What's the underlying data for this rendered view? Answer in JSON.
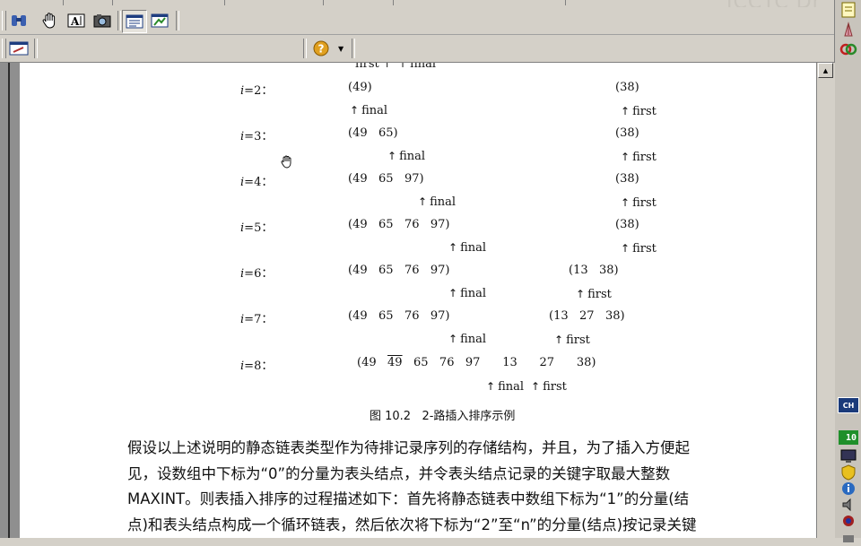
{
  "watermark": "ICCTC Dr",
  "toolbar": {
    "help_label": "?"
  },
  "taskbar": {
    "ime_label": "CH",
    "counter_label": "10"
  },
  "doc": {
    "top_partial": {
      "first": "first",
      "final": "final"
    },
    "rows": [
      {
        "index": "i",
        "num": "=2：",
        "left": "(49)",
        "right": "(38)"
      },
      {
        "index": "i",
        "num": "=3：",
        "left": "(49   65)",
        "right": "(38)"
      },
      {
        "index": "i",
        "num": "=4：",
        "left": "(49   65   97)",
        "right": "(38)"
      },
      {
        "index": "i",
        "num": "=5：",
        "left": "(49   65   76   97)",
        "right": "(38)"
      },
      {
        "index": "i",
        "num": "=6：",
        "left": "(49   65   76   97)",
        "right": "(13   38)"
      },
      {
        "index": "i",
        "num": "=7：",
        "left": "(49   65   76   97)",
        "right": "(13   27   38)"
      },
      {
        "index": "i",
        "num": "=8：",
        "left_open": "(49",
        "left_over": "49",
        "left_rest": "65   76   97      13      27      38)"
      }
    ],
    "pointers": {
      "final": "final",
      "first": "first"
    },
    "caption": "图 10.2   2-路插入排序示例",
    "paragraph": [
      "假设以上述说明的静态链表类型作为待排记录序列的存储结构，并且，为了插入方便起",
      "见，设数组中下标为“0”的分量为表头结点，并令表头结点记录的关键字取最大整数",
      "MAXINT。则表插入排序的过程描述如下：首先将静态链表中数组下标为“1”的分量(结",
      "点)和表头结点构成一个循环链表，然后依次将下标为“2”至“n”的分量(结点)按记录关键"
    ]
  }
}
